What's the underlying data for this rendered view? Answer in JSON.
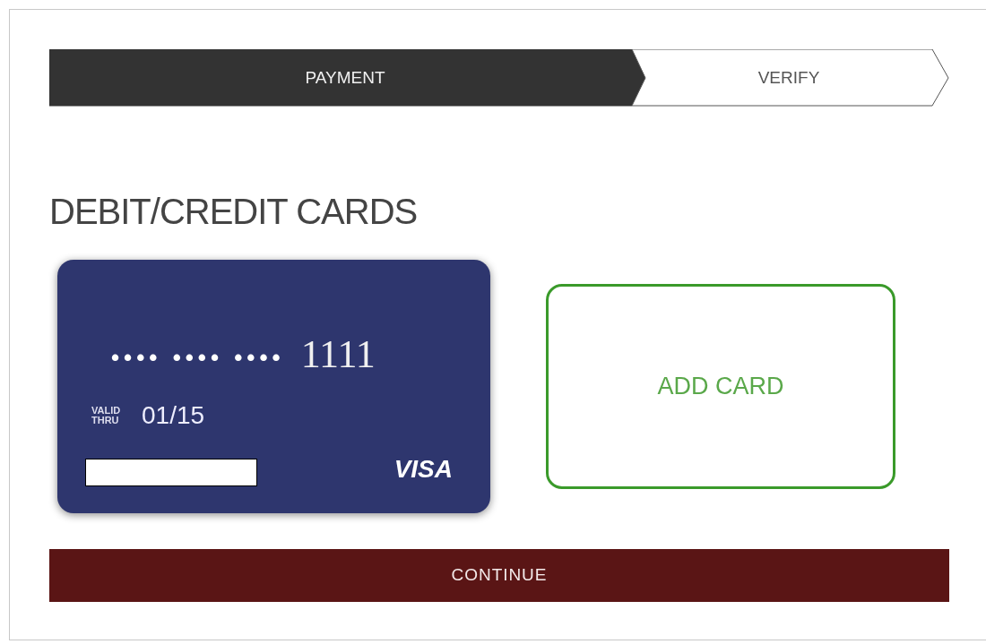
{
  "steps": [
    {
      "label": "PAYMENT",
      "selected": true
    },
    {
      "label": "VERIFY",
      "selected": false
    }
  ],
  "heading": "DEBIT/CREDIT CARDS",
  "cards": [
    {
      "kind": "saved",
      "masked": "•••• •••• ••••",
      "last4": "1111",
      "valid_label": "VALID THRU",
      "expiry": "01/15",
      "brand": "VISA"
    },
    {
      "kind": "add",
      "label": "ADD CARD"
    }
  ],
  "continue_button": "CONTINUE"
}
